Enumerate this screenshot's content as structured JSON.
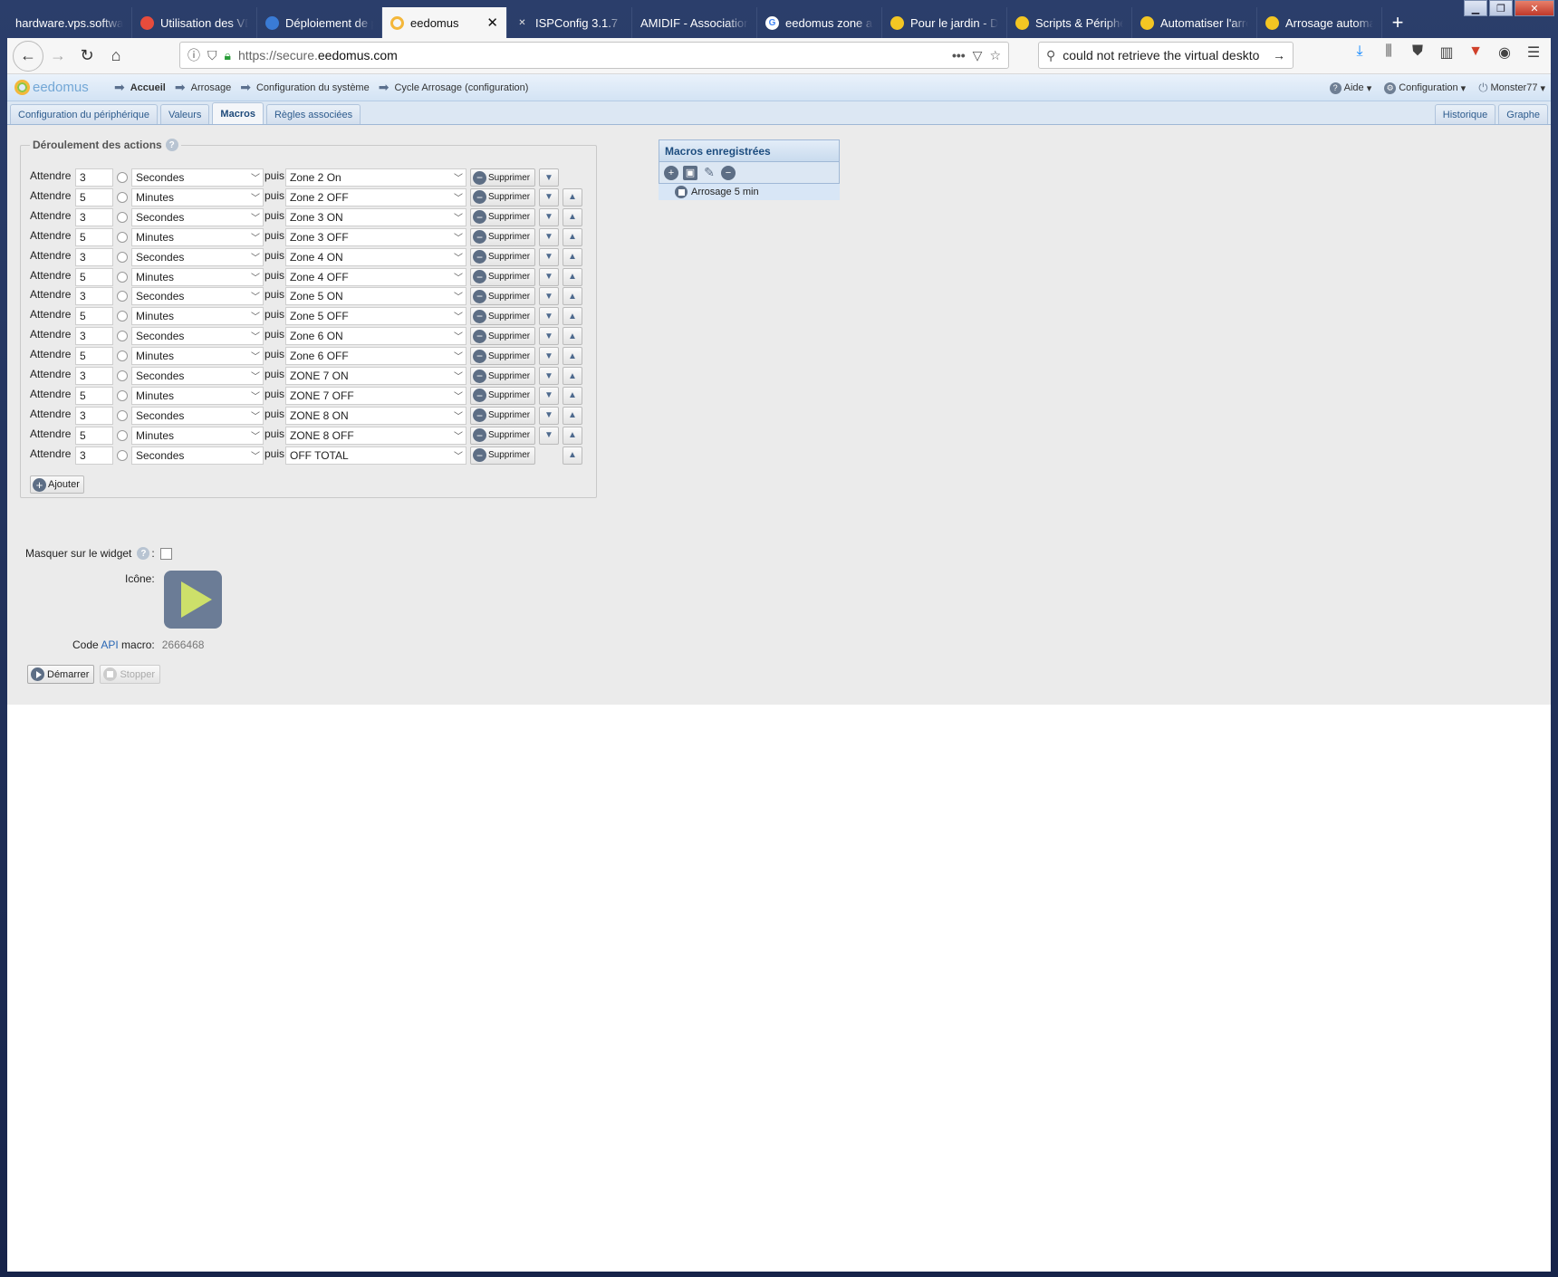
{
  "browser": {
    "tabs": [
      {
        "title": "hardware.vps.software",
        "icon": "none"
      },
      {
        "title": "Utilisation des VDI",
        "icon": "red-doc-icon"
      },
      {
        "title": "Déploiement de p",
        "icon": "windows-icon"
      },
      {
        "title": "eedomus",
        "icon": "eedomus-icon",
        "active": true
      },
      {
        "title": "ISPConfig 3.1.7",
        "icon": "tools-icon"
      },
      {
        "title": "AMIDIF - Association",
        "icon": "none"
      },
      {
        "title": "eedomus zone arr",
        "icon": "google-icon"
      },
      {
        "title": "Pour le jardin - Do",
        "icon": "forum-icon"
      },
      {
        "title": "Scripts & Périphé",
        "icon": "forum-icon"
      },
      {
        "title": "Automatiser l'arro",
        "icon": "forum-icon"
      },
      {
        "title": "Arrosage automat",
        "icon": "forum-icon"
      }
    ],
    "url_prefix": "https://secure.",
    "url_domain": "eedomus.com",
    "search_text": "could not retrieve the virtual deskto"
  },
  "header": {
    "logo": "eedomus",
    "breadcrumbs": [
      "Accueil",
      "Arrosage",
      "Configuration du système",
      "Cycle Arrosage (configuration)"
    ],
    "help": "Aide",
    "config": "Configuration",
    "user": "Monster77"
  },
  "tabs": {
    "left": [
      "Configuration du périphérique",
      "Valeurs",
      "Macros",
      "Règles associées"
    ],
    "active": "Macros",
    "right": [
      "Historique",
      "Graphe"
    ]
  },
  "actions": {
    "legend": "Déroulement des actions",
    "wait_label": "Attendre",
    "then_label": "puis",
    "delete_label": "Supprimer",
    "add_label": "Ajouter",
    "rows": [
      {
        "value": "3",
        "unit": "Secondes",
        "device": "Zone 2 On"
      },
      {
        "value": "5",
        "unit": "Minutes",
        "device": "Zone 2 OFF"
      },
      {
        "value": "3",
        "unit": "Secondes",
        "device": "Zone 3 ON"
      },
      {
        "value": "5",
        "unit": "Minutes",
        "device": "Zone 3 OFF"
      },
      {
        "value": "3",
        "unit": "Secondes",
        "device": "Zone 4 ON"
      },
      {
        "value": "5",
        "unit": "Minutes",
        "device": "Zone 4 OFF"
      },
      {
        "value": "3",
        "unit": "Secondes",
        "device": "Zone 5 ON"
      },
      {
        "value": "5",
        "unit": "Minutes",
        "device": "Zone 5 OFF"
      },
      {
        "value": "3",
        "unit": "Secondes",
        "device": "Zone 6 ON"
      },
      {
        "value": "5",
        "unit": "Minutes",
        "device": "Zone 6 OFF"
      },
      {
        "value": "3",
        "unit": "Secondes",
        "device": "ZONE 7 ON"
      },
      {
        "value": "5",
        "unit": "Minutes",
        "device": "ZONE 7 OFF"
      },
      {
        "value": "3",
        "unit": "Secondes",
        "device": "ZONE 8 ON"
      },
      {
        "value": "5",
        "unit": "Minutes",
        "device": "ZONE 8 OFF"
      },
      {
        "value": "3",
        "unit": "Secondes",
        "device": "OFF TOTAL"
      }
    ]
  },
  "options": {
    "hide_widget_label": "Masquer sur le widget",
    "hide_widget_suffix": ":",
    "icon_label": "Icône:",
    "code_label_1": "Code",
    "code_link": "API",
    "code_label_2": "macro:",
    "code_value": "2666468",
    "start_label": "Démarrer",
    "stop_label": "Stopper"
  },
  "macros_panel": {
    "title": "Macros enregistrées",
    "items": [
      "Arrosage 5 min"
    ]
  },
  "colors": {
    "accent": "#1d4d7f",
    "play_bg": "#6b7c96",
    "play_fg": "#cde06a"
  }
}
